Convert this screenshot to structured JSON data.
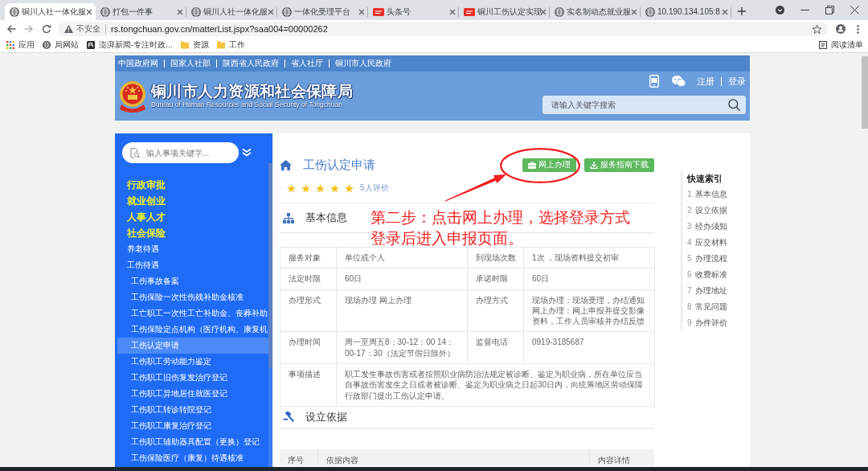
{
  "browser": {
    "tabs": [
      {
        "title": "铜川人社一体化服",
        "kind": "globe",
        "selected": true
      },
      {
        "title": "打包一件事",
        "kind": "globe",
        "selected": false
      },
      {
        "title": "铜川人社一体化服",
        "kind": "globe",
        "selected": false
      },
      {
        "title": "一体化受理平台",
        "kind": "globe",
        "selected": false
      },
      {
        "title": "头条号",
        "kind": "badge",
        "selected": false
      },
      {
        "title": "铜川工伤认定实现",
        "kind": "badge",
        "selected": false
      },
      {
        "title": "实名制动态就业服",
        "kind": "globe",
        "selected": false
      },
      {
        "title": "10.190.134.105:8",
        "kind": "globe",
        "selected": false
      }
    ],
    "address_bar": {
      "security": "不安全",
      "url": "rs.tongchuan.gov.cn/matterList.jspx?saa004=00000262"
    },
    "bookmarks": [
      {
        "label": "应用",
        "kind": "apps"
      },
      {
        "label": "局网站",
        "kind": "globe"
      },
      {
        "label": "澎湃新闻-专注时政...",
        "kind": "news"
      },
      {
        "label": "资源",
        "kind": "folder"
      },
      {
        "label": "工作",
        "kind": "folder"
      }
    ],
    "reading_list": "阅读清单"
  },
  "site_header": {
    "top_links": [
      "中国政府网",
      "国家人社部",
      "陕西省人民政府",
      "省人社厅",
      "铜川市人民政府"
    ],
    "title": "铜川市人力资源和社会保障局",
    "subtitle": "Bureau of Human Resources and Social Security of Tongchuan",
    "user_links": [
      "注册",
      "登录"
    ],
    "search": {
      "placeholder": "请输入关键字搜索"
    }
  },
  "sidebar": {
    "search": {
      "placeholder": "输入事项关键字..."
    },
    "items": [
      {
        "label": "行政审批",
        "selected": false
      },
      {
        "label": "就业创业",
        "selected": false
      },
      {
        "label": "人事人才",
        "selected": false
      },
      {
        "label": "社会保险",
        "selected": false,
        "children": [
          {
            "label": "养老待遇",
            "selected": false
          },
          {
            "label": "工伤待遇",
            "selected": false,
            "children": [
              {
                "label": "工伤事故备案",
                "selected": false
              },
              {
                "label": "工伤保险一次性伤残补助金核准",
                "selected": false
              },
              {
                "label": "工亡职工一次性工亡补助金、丧葬补助",
                "selected": false
              },
              {
                "label": "工伤保险定点机构（医疗机构、康复机",
                "selected": false
              },
              {
                "label": "工伤认定申请",
                "selected": true
              },
              {
                "label": "工伤职工劳动能力鉴定",
                "selected": false
              },
              {
                "label": "工伤职工旧伤复发治疗登记",
                "selected": false
              },
              {
                "label": "工伤职工异地居住就医登记",
                "selected": false
              },
              {
                "label": "工伤职工转诊转院登记",
                "selected": false
              },
              {
                "label": "工伤职工康复治疗登记",
                "selected": false
              },
              {
                "label": "工伤职工辅助器具配置（更换）登记",
                "selected": false
              },
              {
                "label": "工伤保险医疗（康复）待遇核准",
                "selected": false
              }
            ]
          }
        ]
      }
    ]
  },
  "main": {
    "title": "工伤认定申请",
    "stars": 5,
    "rating_count": "5人评价",
    "buttons": [
      {
        "label": "网上办理",
        "kind": "online"
      },
      {
        "label": "服务指南下载",
        "kind": "download"
      }
    ],
    "sections": [
      {
        "kind": "info",
        "title": "基本信息",
        "rows": [
          [
            "服务对象",
            "单位或个人",
            "到现场次数",
            "1次 ，现场资料提交初审"
          ],
          [
            "法定时限",
            "60日",
            "承诺时限",
            "60日"
          ],
          [
            "办理形式",
            "现场办理 网上办理",
            "办理方式",
            "现场办理：现场受理，办结通知网上办理：网上申报并提交影像资料，工作人员审核并办结反馈"
          ],
          [
            "办理时间",
            "周一至周五8：30-12：00 14：00-17：30（法定节假日除外）",
            "监督电话",
            "0919-3185687"
          ],
          [
            "事项描述",
            {
              "text": "职工发生事故伤害或者按照职业病防治法规定被诊断、鉴定为职业病，所在单位应当自事故伤害发生之日或者被诊断、鉴定为职业病之日起30日内，向统筹地区劳动保障行政部门提出工伤认定申请。",
              "colspan": 3
            }
          ]
        ]
      },
      {
        "kind": "basis",
        "title": "设立依据",
        "columns": [
          "序号",
          "依据内容",
          "内容详情"
        ]
      }
    ]
  },
  "annotation": {
    "lines": [
      "第二步：点击网上办理，选择登录方式",
      "登录后进入申报页面。"
    ]
  },
  "quick_index": {
    "title": "快速索引",
    "items": [
      {
        "number": "1",
        "label": "基本信息"
      },
      {
        "number": "2",
        "label": "设立依据"
      },
      {
        "number": "3",
        "label": "经办须知"
      },
      {
        "number": "4",
        "label": "应交材料"
      },
      {
        "number": "5",
        "label": "办理流程"
      },
      {
        "number": "6",
        "label": "收费标准"
      },
      {
        "number": "7",
        "label": "办理地址"
      },
      {
        "number": "8",
        "label": "常见问题"
      },
      {
        "number": "9",
        "label": "办件评价"
      }
    ]
  }
}
